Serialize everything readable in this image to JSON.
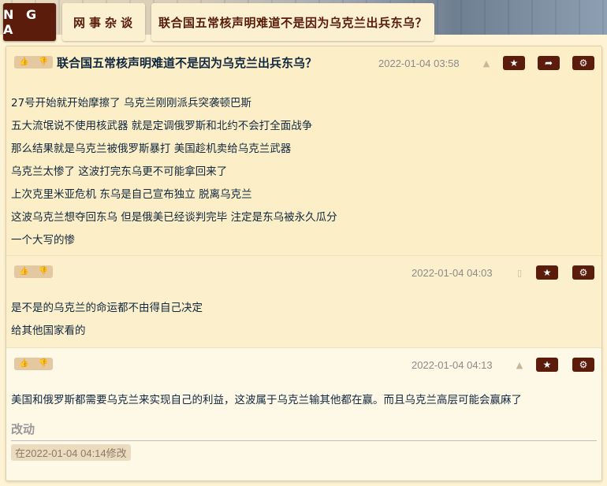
{
  "header": {
    "logo": "N G A",
    "forum": "网事杂谈",
    "thread_title": "联合国五常核声明难道不是因为乌克兰出兵东乌？"
  },
  "posts": [
    {
      "title": "联合国五常核声明难道不是因为乌克兰出兵东乌？",
      "date": "2022-01-04 03:58",
      "device_icon": "android-icon",
      "lines": [
        "27号开始就开始摩擦了 乌克兰刚刚派兵突袭顿巴斯",
        "五大流氓说不使用核武器 就是定调俄罗斯和北约不会打全面战争",
        "那么结果就是乌克兰被俄罗斯暴打 美国趁机卖给乌克兰武器",
        "乌克兰太惨了 这波打完东乌更不可能拿回来了",
        "上次克里米亚危机 东乌是自己宣布独立 脱离乌克兰",
        "这波乌克兰想夺回东乌 但是俄美已经谈判完毕 注定是东乌被永久瓜分",
        "一个大写的惨"
      ]
    },
    {
      "date": "2022-01-04 04:03",
      "device_icon": "phone-icon",
      "lines": [
        "是不是的乌克兰的命运都不由得自己决定",
        "给其他国家看的"
      ]
    },
    {
      "date": "2022-01-04 04:13",
      "device_icon": "android-icon",
      "lines": [
        "美国和俄罗斯都需要乌克兰来实现自己的利益，这波属于乌克兰输其他都在赢。而且乌克兰高层可能会赢麻了"
      ],
      "edit_title": "改动",
      "edit_note": "在2022-01-04 04:14修改"
    }
  ],
  "icons": {
    "thumb_up": "👍",
    "thumb_down": "👎",
    "star": "★",
    "share": "➦",
    "gear": "⚙"
  },
  "colors": {
    "brand": "#5b1c0c",
    "page_bg": "#fef3d4"
  }
}
